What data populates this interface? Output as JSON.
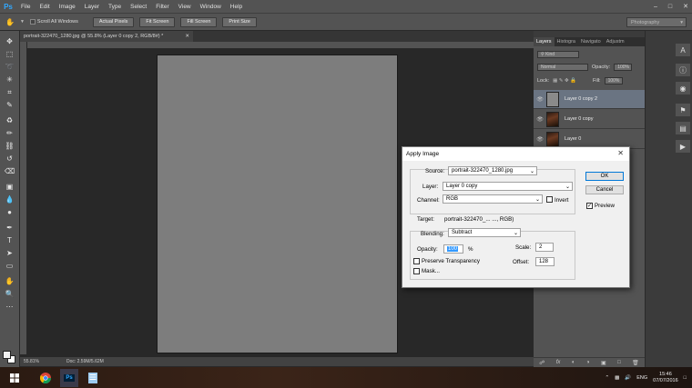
{
  "menubar": {
    "logo": "Ps",
    "items": [
      "File",
      "Edit",
      "Image",
      "Layer",
      "Type",
      "Select",
      "Filter",
      "View",
      "Window",
      "Help"
    ]
  },
  "options": {
    "scroll_all": "Scroll All Windows",
    "actual_pixels": "Actual Pixels",
    "fit_screen": "Fit Screen",
    "fill_screen": "Fill Screen",
    "print_size": "Print Size",
    "workspace": "Photography"
  },
  "document": {
    "tab_title": "portrait-322470_1280.jpg @ 55.8% (Layer 0 copy 2, RGB/8#) *",
    "zoom": "55.81%",
    "doc_size": "Doc: 2.59M/5.62M"
  },
  "layers_panel": {
    "tabs": [
      "Layers",
      "Histogra",
      "Navigato",
      "Adjustm"
    ],
    "kind": "Kind",
    "blend_mode": "Normal",
    "opacity_label": "Opacity:",
    "opacity_value": "100%",
    "lock_label": "Lock:",
    "fill_label": "Fill:",
    "fill_value": "100%",
    "layers": [
      {
        "name": "Layer 0 copy 2",
        "selected": true,
        "thumb": "gray"
      },
      {
        "name": "Layer 0 copy",
        "selected": false,
        "thumb": "photo"
      },
      {
        "name": "Layer 0",
        "selected": false,
        "thumb": "photo"
      }
    ]
  },
  "dialog": {
    "title": "Apply Image",
    "source_label": "Source:",
    "source_value": "portrait-322470_1280.jpg",
    "layer_label": "Layer:",
    "layer_value": "Layer 0 copy",
    "channel_label": "Channel:",
    "channel_value": "RGB",
    "invert_label": "Invert",
    "target_label": "Target:",
    "target_value": "portrait-322470_... ..., RGB)",
    "blending_label": "Blending:",
    "blending_value": "Subtract",
    "opacity_label": "Opacity:",
    "opacity_value": "100",
    "opacity_unit": "%",
    "scale_label": "Scale:",
    "scale_value": "2",
    "offset_label": "Offset:",
    "offset_value": "128",
    "preserve_label": "Preserve Transparency",
    "mask_label": "Mask...",
    "ok_label": "OK",
    "cancel_label": "Cancel",
    "preview_label": "Preview",
    "preview_checked": "✓"
  },
  "taskbar": {
    "lang": "ENG",
    "time": "15:46",
    "date": "07/07/2016"
  }
}
